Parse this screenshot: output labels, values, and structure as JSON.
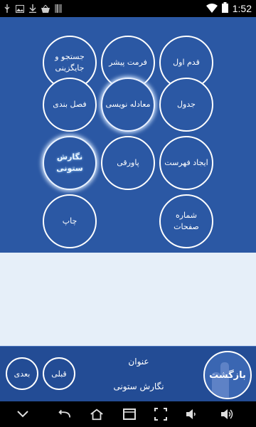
{
  "status_bar": {
    "time": "1:52",
    "icons": [
      "usb-icon",
      "image-icon",
      "download-icon",
      "basket-icon",
      "barcode-icon",
      "wifi-icon",
      "battery-icon"
    ]
  },
  "grid": {
    "items": [
      {
        "label": "قدم اول"
      },
      {
        "label": "فرمت پیشر"
      },
      {
        "label": "جستجو و\nجایگزینی"
      },
      {
        "label": "جدول"
      },
      {
        "label": "معادله نویسی"
      },
      {
        "label": "فصل بندی"
      },
      {
        "label": "ایجاد فهرست"
      },
      {
        "label": "پاورقی"
      },
      {
        "label": "نگارش ستونی"
      },
      {
        "label": "شماره صفحات"
      },
      {
        "label": "چاپ"
      }
    ]
  },
  "bottom_bar": {
    "back_label": "بازگشت",
    "title_label": "عنوان",
    "title_value": "نگارش ستونی",
    "prev_label": "قبلی",
    "next_label": "بعدی"
  },
  "colors": {
    "primary": "#2b58a4",
    "bottom_bar": "#234c95",
    "panel": "#e6eff9"
  },
  "nav_bar": {
    "icons": [
      "chevron-down-icon",
      "back-nav-icon",
      "home-nav-icon",
      "recents-nav-icon",
      "screenshot-icon",
      "volume-down-icon",
      "volume-up-icon"
    ]
  }
}
